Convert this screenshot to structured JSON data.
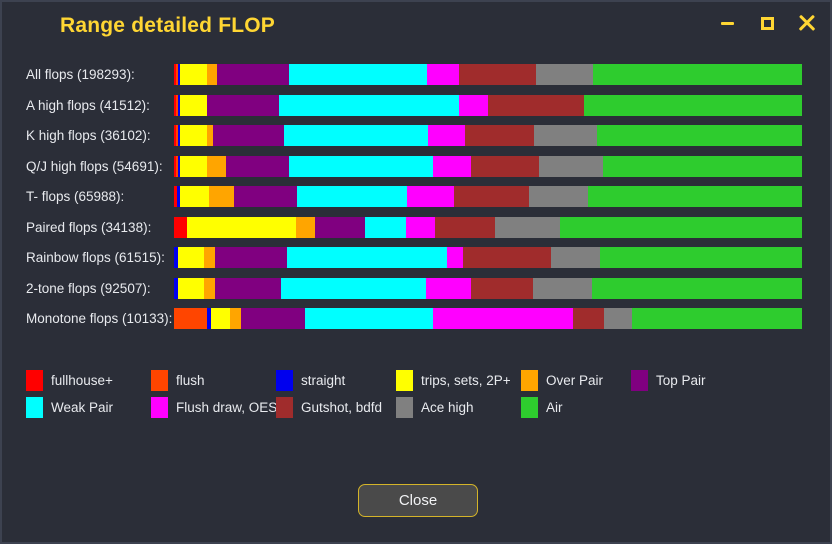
{
  "window": {
    "title": "Range detailed FLOP",
    "minimize_label": "–",
    "maximize_label": "□",
    "close_label": "×",
    "accent_color": "#ffd633",
    "background_color": "#2b2e38",
    "text_color": "#e8eaee"
  },
  "footer": {
    "close_label": "Close"
  },
  "legend": {
    "rows": [
      [
        {
          "label": "fullhouse+",
          "color": "#ff0000"
        },
        {
          "label": "flush",
          "color": "#ff4500"
        },
        {
          "label": "straight",
          "color": "#0000ee"
        },
        {
          "label": "trips, sets, 2P+",
          "color": "#ffff00"
        },
        {
          "label": "Over Pair",
          "color": "#ffa500"
        },
        {
          "label": "Top Pair",
          "color": "#800080"
        }
      ],
      [
        {
          "label": "Weak Pair",
          "color": "#00ffff"
        },
        {
          "label": "Flush draw, OESD",
          "color": "#ff00ff"
        },
        {
          "label": "Gutshot, bdfd",
          "color": "#a02c2c"
        },
        {
          "label": "Ace high",
          "color": "#808080"
        },
        {
          "label": "Air",
          "color": "#2ecc2e"
        }
      ]
    ]
  },
  "chart_data": {
    "type": "bar",
    "title": "Range detailed FLOP",
    "orientation": "horizontal-stacked",
    "xlabel": "",
    "ylabel": "",
    "xlim": [
      0,
      100
    ],
    "grid": false,
    "legend_position": "bottom",
    "categories": [
      "fullhouse+",
      "flush",
      "straight",
      "trips, sets, 2P+",
      "Over Pair",
      "Top Pair",
      "Weak Pair",
      "Flush draw, OESD",
      "Gutshot, bdfd",
      "Ace high",
      "Air"
    ],
    "colors": [
      "#ff0000",
      "#ff4500",
      "#0000ee",
      "#ffff00",
      "#ffa500",
      "#800080",
      "#00ffff",
      "#ff00ff",
      "#a02c2c",
      "#808080",
      "#2ecc2e"
    ],
    "rows": [
      {
        "label": "All flops (198293):",
        "name": "All flops",
        "count": 198293,
        "values": [
          0.3,
          0.3,
          0.3,
          4.3,
          1.6,
          11.5,
          22.0,
          5.1,
          12.3,
          9.1,
          33.2
        ]
      },
      {
        "label": "A high flops (41512):",
        "name": "A high flops",
        "count": 41512,
        "values": [
          0.3,
          0.3,
          0.3,
          4.3,
          0.0,
          11.5,
          28.7,
          4.6,
          15.3,
          0.0,
          34.7
        ]
      },
      {
        "label": "K high flops (36102):",
        "name": "K high flops",
        "count": 36102,
        "values": [
          0.3,
          0.3,
          0.3,
          4.3,
          1.0,
          11.3,
          22.9,
          6.0,
          11.0,
          10.0,
          32.6
        ]
      },
      {
        "label": "Q/J high flops (54691):",
        "name": "Q/J high flops",
        "count": 54691,
        "values": [
          0.3,
          0.3,
          0.3,
          4.4,
          3.0,
          10.0,
          22.9,
          6.1,
          10.9,
          10.1,
          31.7
        ]
      },
      {
        "label": "T- flops (65988):",
        "name": "T- flops",
        "count": 65988,
        "values": [
          0.5,
          0.0,
          0.5,
          4.6,
          4.0,
          10.0,
          17.5,
          7.5,
          11.9,
          9.4,
          34.1
        ]
      },
      {
        "label": "Paired flops (34138):",
        "name": "Paired flops",
        "count": 34138,
        "values": [
          2.0,
          0.0,
          0.0,
          17.4,
          3.0,
          8.0,
          6.5,
          4.6,
          9.7,
          10.3,
          38.5
        ]
      },
      {
        "label": "Rainbow flops (61515):",
        "name": "Rainbow flops",
        "count": 61515,
        "values": [
          0.0,
          0.0,
          0.6,
          4.2,
          1.8,
          11.4,
          25.4,
          2.7,
          14.0,
          7.8,
          32.1
        ]
      },
      {
        "label": "2-tone flops (92507):",
        "name": "2-tone flops",
        "count": 92507,
        "values": [
          0.0,
          0.0,
          0.6,
          4.2,
          1.8,
          10.4,
          23.2,
          7.1,
          9.9,
          9.4,
          33.4
        ]
      },
      {
        "label": "Monotone flops (10133):",
        "name": "Monotone flops",
        "count": 10133,
        "values": [
          0.0,
          5.3,
          0.6,
          3.0,
          1.8,
          10.2,
          20.4,
          22.3,
          4.8,
          4.5,
          27.1
        ]
      }
    ]
  }
}
